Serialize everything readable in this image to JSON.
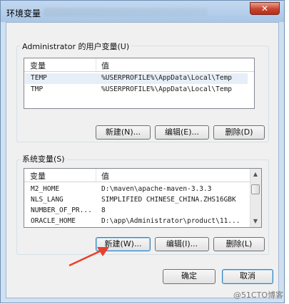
{
  "window": {
    "title": "环境变量",
    "close_symbol": "✕"
  },
  "user_vars": {
    "group_label": "Administrator 的用户变量(U)",
    "columns": [
      "变量",
      "值"
    ],
    "rows": [
      {
        "name": "TEMP",
        "value": "%USERPROFILE%\\AppData\\Local\\Temp"
      },
      {
        "name": "TMP",
        "value": "%USERPROFILE%\\AppData\\Local\\Temp"
      }
    ],
    "buttons": {
      "new": "新建(N)...",
      "edit": "编辑(E)...",
      "delete": "删除(D)"
    }
  },
  "system_vars": {
    "group_label": "系统变量(S)",
    "columns": [
      "变量",
      "值"
    ],
    "rows": [
      {
        "name": "M2_HOME",
        "value": "D:\\maven\\apache-maven-3.3.3"
      },
      {
        "name": "NLS_LANG",
        "value": "SIMPLIFIED CHINESE_CHINA.ZHS16GBK"
      },
      {
        "name": "NUMBER_OF_PR...",
        "value": "8"
      },
      {
        "name": "ORACLE_HOME",
        "value": "D:\\app\\Administrator\\product\\11..."
      }
    ],
    "buttons": {
      "new": "新建(W)...",
      "edit": "编辑(I)...",
      "delete": "删除(L)"
    }
  },
  "footer": {
    "ok": "确定",
    "cancel": "取消"
  },
  "watermark": "@51CTO博客",
  "colors": {
    "accent_border": "#3c7fb1",
    "annotation_arrow": "#e8402c",
    "close_button": "#c7432c"
  }
}
